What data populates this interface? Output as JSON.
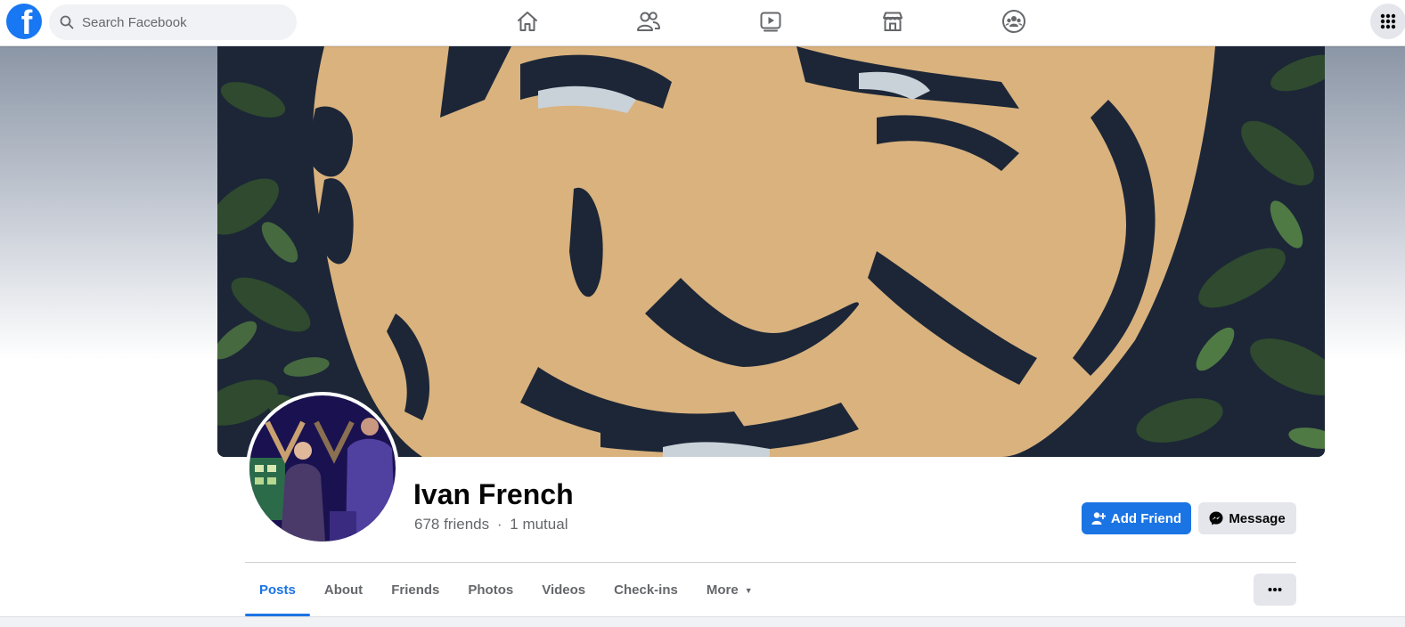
{
  "search": {
    "placeholder": "Search Facebook"
  },
  "nav": [
    "home-icon",
    "friends-icon",
    "watch-icon",
    "marketplace-icon",
    "groups-icon"
  ],
  "menu_icon": "grid-menu-icon",
  "profile": {
    "name": "Ivan French",
    "friends_count": "678 friends",
    "separator": "·",
    "mutual": "1 mutual"
  },
  "actions": {
    "add_friend": "Add Friend",
    "message": "Message"
  },
  "tabs": [
    {
      "label": "Posts",
      "active": true
    },
    {
      "label": "About"
    },
    {
      "label": "Friends"
    },
    {
      "label": "Photos"
    },
    {
      "label": "Videos"
    },
    {
      "label": "Check-ins"
    },
    {
      "label": "More"
    }
  ],
  "colors": {
    "brand": "#1877f2",
    "accent": "#1b74e4",
    "secondary_text": "#65676b"
  }
}
